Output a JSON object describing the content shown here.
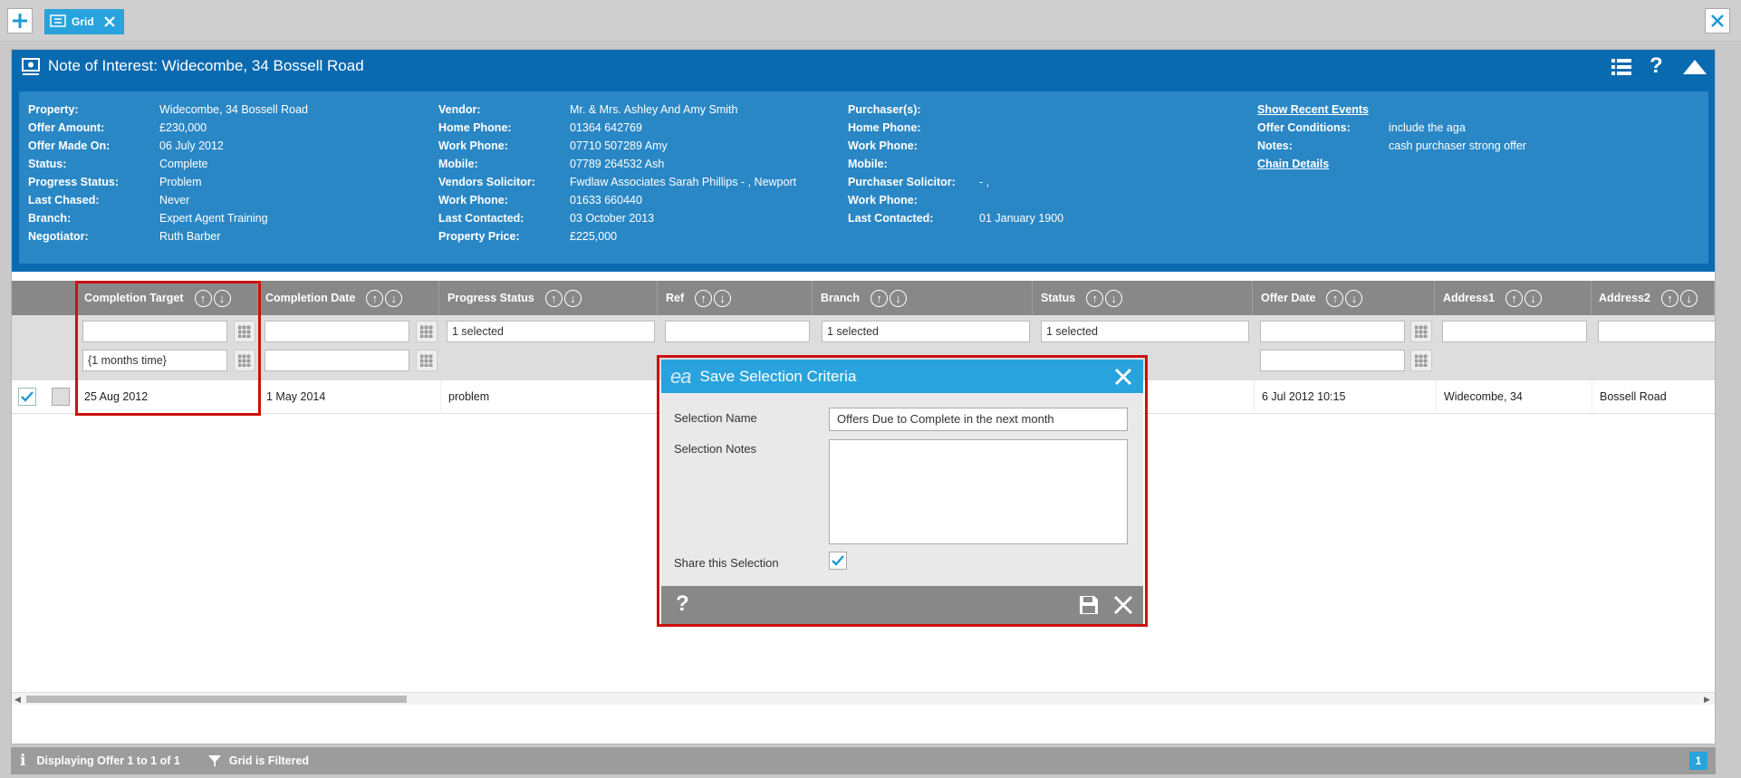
{
  "topbar": {
    "tab_label": "Grid"
  },
  "header": {
    "title": "Note of Interest: Widecombe, 34 Bossell Road",
    "card1": [
      {
        "k": "Property:",
        "v": "Widecombe, 34 Bossell Road"
      },
      {
        "k": "Offer Amount:",
        "v": "£230,000"
      },
      {
        "k": "Offer Made On:",
        "v": "06 July 2012"
      },
      {
        "k": "Status:",
        "v": "Complete"
      },
      {
        "k": "Progress Status:",
        "v": "Problem"
      },
      {
        "k": "Last Chased:",
        "v": "Never"
      },
      {
        "k": "Branch:",
        "v": "Expert Agent Training"
      },
      {
        "k": "Negotiator:",
        "v": "Ruth Barber"
      }
    ],
    "card2": [
      {
        "k": "Vendor:",
        "v": "Mr. & Mrs. Ashley And Amy Smith"
      },
      {
        "k": "Home Phone:",
        "v": "01364 642769"
      },
      {
        "k": "Work Phone:",
        "v": "07710 507289 Amy"
      },
      {
        "k": "Mobile:",
        "v": "07789 264532 Ash"
      },
      {
        "k": "Vendors Solicitor:",
        "v": "Fwdlaw Associates Sarah Phillips - , Newport"
      },
      {
        "k": "Work Phone:",
        "v": "01633 660440"
      },
      {
        "k": "Last Contacted:",
        "v": "03 October 2013"
      },
      {
        "k": "Property Price:",
        "v": "£225,000"
      }
    ],
    "card3": [
      {
        "k": "Purchaser(s):",
        "v": ""
      },
      {
        "k": "Home Phone:",
        "v": ""
      },
      {
        "k": "Work Phone:",
        "v": ""
      },
      {
        "k": "Mobile:",
        "v": ""
      },
      {
        "k": "Purchaser Solicitor:",
        "v": "- ,"
      },
      {
        "k": "Work Phone:",
        "v": ""
      },
      {
        "k": "Last Contacted:",
        "v": "01 January 1900"
      }
    ],
    "card4": {
      "show_recent": "Show Recent Events",
      "offer_conditions_k": "Offer Conditions:",
      "offer_conditions_v": "include the aga",
      "notes_k": "Notes:",
      "notes_v": "cash purchaser strong offer",
      "chain": "Chain Details"
    }
  },
  "grid": {
    "columns": [
      "Completion Target",
      "Completion Date",
      "Progress Status",
      "Ref",
      "Branch",
      "Status",
      "Offer Date",
      "Address1",
      "Address2"
    ],
    "filters": {
      "completion_target_2": "{1 months time}",
      "progress_status": "1 selected",
      "branch": "1 selected",
      "status": "1 selected"
    },
    "row": {
      "completion_target": "25 Aug 2012",
      "completion_date": "1 May 2014",
      "progress_status": "problem",
      "offer_date": "6 Jul 2012 10:15",
      "address1": "Widecombe, 34",
      "address2": "Bossell Road"
    }
  },
  "modal": {
    "title": "Save Selection Criteria",
    "name_label": "Selection Name",
    "name_value": "Offers Due to Complete in the next month",
    "notes_label": "Selection Notes",
    "share_label": "Share this Selection"
  },
  "status": {
    "displaying": "Displaying Offer 1 to 1 of 1",
    "filtered": "Grid is Filtered",
    "page": "1"
  }
}
